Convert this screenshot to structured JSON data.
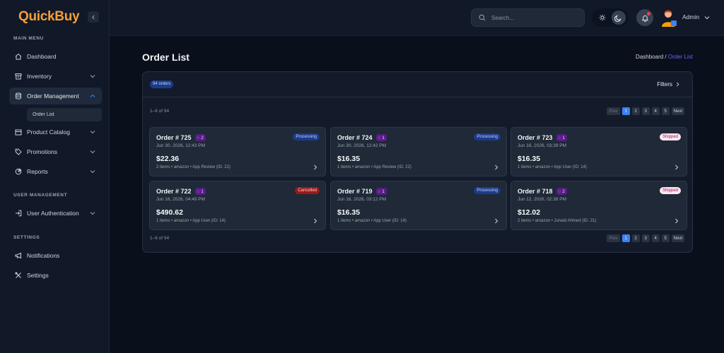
{
  "app": {
    "name": "QuickBuy"
  },
  "sidebar": {
    "sections": [
      "MAIN MENU",
      "USER MANAGEMENT",
      "SETTINGS"
    ],
    "items": [
      {
        "label": "Dashboard",
        "icon": "home-icon"
      },
      {
        "label": "Inventory",
        "icon": "box-icon"
      },
      {
        "label": "Order Management",
        "icon": "database-icon"
      },
      {
        "label": "Product Catalog",
        "icon": "catalog-icon"
      },
      {
        "label": "Promotions",
        "icon": "tag-icon"
      },
      {
        "label": "Reports",
        "icon": "piechart-icon"
      },
      {
        "label": "User Authentication",
        "icon": "login-icon"
      },
      {
        "label": "Notifications",
        "icon": "megaphone-icon"
      },
      {
        "label": "Settings",
        "icon": "tools-icon"
      }
    ],
    "sub_item": "Order List"
  },
  "topbar": {
    "search_placeholder": "Search...",
    "user": "Admin"
  },
  "page": {
    "title": "Order List",
    "breadcrumb_root": "Dashboard /",
    "breadcrumb_current": "Order List"
  },
  "panel": {
    "count_badge": "94 orders",
    "filters": "Filters",
    "range_top": "1–6 of 94",
    "range_bottom": "1–6 of 94",
    "pager": {
      "prev": "Prev",
      "pages": [
        "1",
        "2",
        "3",
        "4",
        "5"
      ],
      "current": "1",
      "next": "Next"
    }
  },
  "orders": [
    {
      "title": "Order # 725",
      "chats": "2",
      "date": "Jun 30, 2026, 12:43 PM",
      "amount": "$22.36",
      "meta": "2 items • amazon • App Review (ID: 22)",
      "status": "Processing"
    },
    {
      "title": "Order # 724",
      "chats": "1",
      "date": "Jun 30, 2026, 12:42 PM",
      "amount": "$16.35",
      "meta": "1 items • amazon • App Review (ID: 22)",
      "status": "Processing"
    },
    {
      "title": "Order # 723",
      "chats": "1",
      "date": "Jun 16, 2026, 03:39 PM",
      "amount": "$16.35",
      "meta": "1 items • amazon • App User (ID: 14)",
      "status": "Shipped"
    },
    {
      "title": "Order # 722",
      "chats": "1",
      "date": "Jun 16, 2026, 04:49 PM",
      "amount": "$490.62",
      "meta": "1 items • amazon • App User (ID: 14)",
      "status": "Cancelled"
    },
    {
      "title": "Order # 719",
      "chats": "1",
      "date": "Jun 16, 2026, 03:12 PM",
      "amount": "$16.35",
      "meta": "1 items • amazon • App User (ID: 14)",
      "status": "Processing"
    },
    {
      "title": "Order # 718",
      "chats": "2",
      "date": "Jun 12, 2026, 02:38 PM",
      "amount": "$12.02",
      "meta": "2 items • amazon • Junaid Ahmed (ID: 21)",
      "status": "Shipped"
    }
  ],
  "colors": {
    "accent": "#3b82f6",
    "logo": "#f59e3b",
    "processing": "#1e3a8a",
    "shipped": "#fce7f3",
    "cancelled": "#991b1b"
  }
}
